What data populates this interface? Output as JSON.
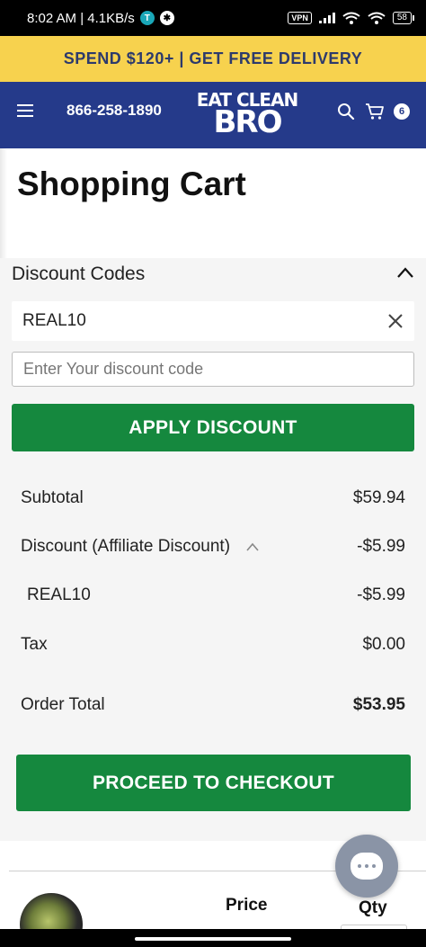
{
  "status_bar": {
    "time_speed": "8:02 AM | 4.1KB/s",
    "vpn": "VPN",
    "battery": "58"
  },
  "promo": {
    "text": "SPEND $120+ | GET FREE DELIVERY"
  },
  "header": {
    "phone": "866-258-1890",
    "logo_line1": "EAT CLEAN",
    "logo_line2": "BRO",
    "cart_count": "6"
  },
  "page": {
    "title": "Shopping Cart"
  },
  "discount": {
    "section_title": "Discount Codes",
    "applied_code": "REAL10",
    "input_value": "",
    "input_placeholder": "Enter Your discount code",
    "apply_label": "APPLY DISCOUNT"
  },
  "summary": {
    "subtotal_label": "Subtotal",
    "subtotal_value": "$59.94",
    "discount_label": "Discount (Affiliate Discount)",
    "discount_value": "-$5.99",
    "code_label": "REAL10",
    "code_value": "-$5.99",
    "tax_label": "Tax",
    "tax_value": "$0.00",
    "total_label": "Order Total",
    "total_value": "$53.95"
  },
  "checkout": {
    "label": "PROCEED TO CHECKOUT"
  },
  "cart_table": {
    "price_header": "Price",
    "qty_header": "Qty"
  },
  "colors": {
    "promo_bg": "#f7d24e",
    "header_bg": "#253a8a",
    "button_green": "#15883e"
  },
  "icons": {
    "menu": "hamburger-icon",
    "search": "search-icon",
    "cart": "cart-icon",
    "collapse": "chevron-up-icon",
    "clear": "close-icon",
    "chat": "chat-icon"
  }
}
